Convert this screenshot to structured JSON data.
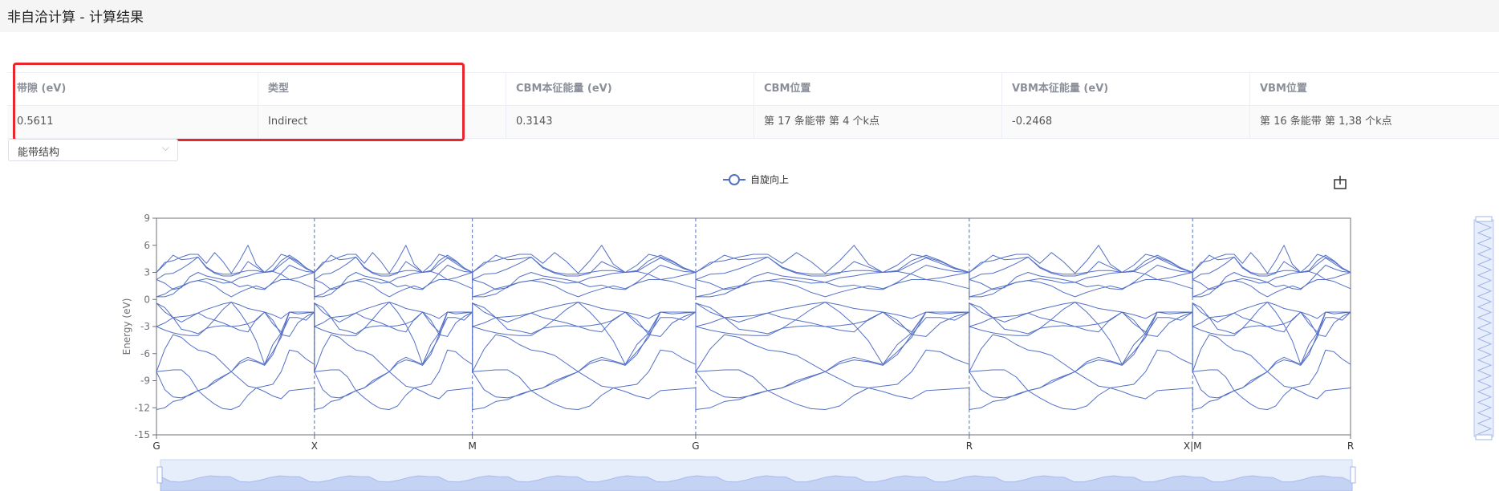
{
  "header": {
    "title": "非自洽计算 - 计算结果"
  },
  "table": {
    "columns": [
      "带隙 (eV)",
      "类型",
      "CBM本征能量 (eV)",
      "CBM位置",
      "VBM本征能量 (eV)",
      "VBM位置"
    ],
    "row": [
      "0.5611",
      "Indirect",
      "0.3143",
      "第 17 条能带 第 4 个k点",
      "-0.2468",
      "第 16 条能带 第 1,38 个k点"
    ]
  },
  "view_select": {
    "value": "能带结构"
  },
  "chart_data": {
    "type": "line",
    "legend": [
      "自旋向上"
    ],
    "ylabel": "Energy  (eV)",
    "ylim": [
      -15,
      9
    ],
    "yticks": [
      9,
      6,
      3,
      0,
      -3,
      -6,
      -9,
      -12,
      -15
    ],
    "x_labels": [
      "G",
      "X",
      "M",
      "G",
      "R",
      "X|M",
      "R"
    ],
    "x_label_positions": [
      0,
      0.5,
      1.0,
      1.707,
      2.573,
      3.28,
      3.78
    ],
    "series_color": "#5470c6",
    "bands": [
      [
        -12.2,
        -12.0,
        -11.3,
        -11.1,
        -10.5,
        -10.1,
        -10.9,
        -11.6,
        -12.1,
        -12.2,
        -11.8,
        -10.6,
        -9.8,
        -10.2,
        -10.7,
        -11.0,
        -10.1,
        -10.0,
        -9.9,
        -9.8
      ],
      [
        -8.0,
        -10.0,
        -10.8,
        -10.9,
        -10.6,
        -10.1,
        -9.8,
        -9.0,
        -8.5,
        -8.0,
        -8.8,
        -9.6,
        -9.8,
        -9.6,
        -9.4,
        -8.0,
        -5.6,
        -5.8,
        -6.6,
        -7.2
      ],
      [
        -8.0,
        -7.9,
        -7.8,
        -7.8,
        -8.6,
        -10.1,
        -9.8,
        -9.2,
        -8.6,
        -8.0,
        -7.1,
        -6.7,
        -6.9,
        -7.3,
        -6.1,
        -3.9,
        -4.1,
        -2.6,
        -1.9,
        -1.4
      ],
      [
        -8.0,
        -5.5,
        -3.9,
        -4.2,
        -5.0,
        -5.6,
        -5.8,
        -6.2,
        -7.1,
        -8.0,
        -6.9,
        -6.4,
        -6.8,
        -7.2,
        -5.0,
        -3.7,
        -1.4,
        -1.4,
        -1.4,
        -1.4
      ],
      [
        -3.0,
        -2.6,
        -2.0,
        -1.9,
        -1.8,
        -1.5,
        -2.0,
        -2.3,
        -2.6,
        -3.0,
        -3.4,
        -3.6,
        -2.2,
        -1.4,
        -2.3,
        -3.9,
        -2.0,
        -2.0,
        -2.3,
        -1.4
      ],
      [
        -3.0,
        -3.4,
        -3.7,
        -3.9,
        -4.0,
        -4.0,
        -3.2,
        -2.2,
        -1.1,
        -0.3,
        -1.4,
        -2.8,
        -4.6,
        -7.2,
        -5.8,
        -4.2,
        -1.4,
        -1.6,
        -1.5,
        -1.4
      ],
      [
        -0.4,
        -1.4,
        -2.0,
        -2.5,
        -2.0,
        -1.5,
        -1.1,
        -0.8,
        -0.5,
        -0.3,
        -0.6,
        -1.0,
        -1.2,
        -1.4,
        -1.7,
        -2.1,
        -1.4,
        -1.4,
        -1.4,
        -1.4
      ],
      [
        -0.4,
        -0.9,
        -2.0,
        -3.3,
        -3.5,
        -3.8,
        -3.2,
        -3.0,
        -2.9,
        -3.0,
        -2.9,
        -2.7,
        -2.3,
        -1.4,
        -2.7,
        -3.6,
        -1.4,
        -1.4,
        -1.4,
        -1.4
      ],
      [
        0.3,
        0.3,
        0.6,
        1.4,
        1.9,
        2.1,
        1.9,
        1.5,
        0.8,
        0.3,
        0.8,
        1.2,
        1.5,
        1.2,
        1.8,
        2.2,
        2.2,
        2.0,
        1.6,
        1.2
      ],
      [
        0.3,
        0.6,
        1.2,
        1.5,
        1.9,
        2.1,
        2.3,
        2.1,
        1.8,
        1.9,
        2.4,
        2.6,
        2.9,
        3.0,
        3.1,
        2.8,
        2.2,
        2.4,
        2.7,
        3.0
      ],
      [
        2.2,
        1.8,
        1.1,
        1.3,
        2.5,
        3.0,
        2.6,
        2.4,
        2.2,
        1.9,
        1.4,
        1.6,
        1.2,
        1.1,
        1.9,
        2.9,
        3.8,
        3.4,
        3.1,
        3.0
      ],
      [
        2.2,
        2.8,
        2.9,
        3.4,
        4.0,
        4.7,
        3.6,
        3.0,
        2.8,
        2.8,
        3.0,
        3.2,
        3.2,
        3.0,
        3.1,
        3.9,
        4.6,
        4.0,
        3.4,
        3.0
      ],
      [
        3.0,
        3.9,
        4.9,
        4.4,
        4.5,
        4.7,
        3.5,
        2.9,
        2.6,
        2.6,
        2.9,
        4.2,
        3.6,
        3.0,
        3.2,
        4.3,
        4.9,
        4.3,
        3.5,
        3.0
      ],
      [
        3.0,
        4.1,
        4.3,
        4.7,
        5.0,
        5.0,
        4.0,
        5.2,
        4.2,
        2.9,
        4.3,
        6.0,
        3.9,
        3.0,
        3.8,
        5.0,
        4.7,
        4.2,
        3.5,
        3.0
      ]
    ]
  }
}
